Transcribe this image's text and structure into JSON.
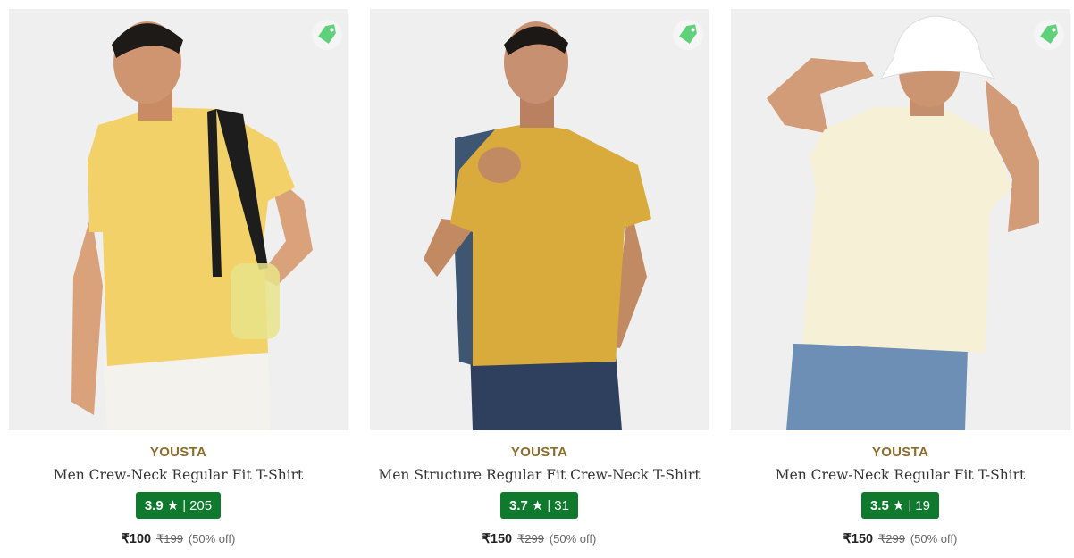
{
  "products": [
    {
      "brand": "YOUSTA",
      "title": "Men Crew-Neck Regular Fit T-Shirt",
      "rating": "3.9",
      "star": "★",
      "sep": "|",
      "reviews": "205",
      "price": "₹100",
      "mrp": "₹199",
      "discount": "(50% off)",
      "tshirt_color": "#f3d169",
      "icon": "price-tag-icon"
    },
    {
      "brand": "YOUSTA",
      "title": "Men Structure Regular Fit Crew-Neck T-Shirt",
      "rating": "3.7",
      "star": "★",
      "sep": "|",
      "reviews": "31",
      "price": "₹150",
      "mrp": "₹299",
      "discount": "(50% off)",
      "tshirt_color": "#d9ab3c",
      "icon": "price-tag-icon"
    },
    {
      "brand": "YOUSTA",
      "title": "Men Crew-Neck Regular Fit T-Shirt",
      "rating": "3.5",
      "star": "★",
      "sep": "|",
      "reviews": "19",
      "price": "₹150",
      "mrp": "₹299",
      "discount": "(50% off)",
      "tshirt_color": "#f6f0d6",
      "icon": "price-tag-icon"
    }
  ],
  "colors": {
    "brand": "#8c6d2b",
    "rating_bg": "#0f7a2e",
    "tag_green": "#5fd17a"
  }
}
